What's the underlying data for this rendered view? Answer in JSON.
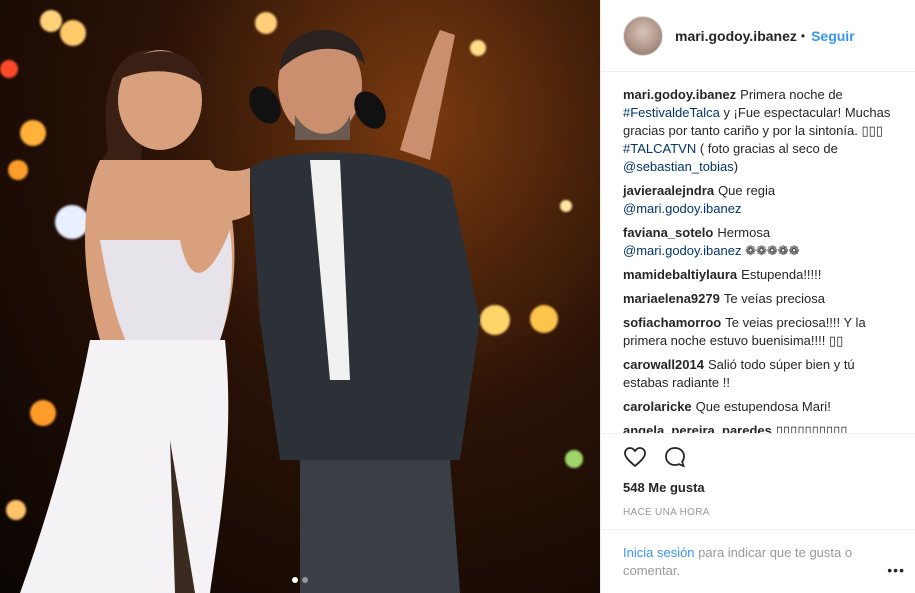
{
  "author": {
    "username": "mari.godoy.ibanez",
    "separator": "•",
    "follow_label": "Seguir"
  },
  "caption": {
    "username": "mari.godoy.ibanez",
    "text_1": "Primera noche de ",
    "hashtag_1": "#FestivaldeTalca",
    "text_2": " y ¡Fue espectacular! Muchas gracias por tanto cariño y por la sintonía. ▯▯▯ ",
    "hashtag_2": "#TALCATVN",
    "text_3": " ( foto gracias al seco de ",
    "mention": "@sebastian_tobias",
    "text_4": ")"
  },
  "comments": [
    {
      "user": "javieraalejndra",
      "text": "Que regia",
      "mention": "@mari.godoy.ibanez",
      "after": ""
    },
    {
      "user": "faviana_sotelo",
      "text": "Hermosa",
      "mention": "@mari.godoy.ibanez",
      "after": " ❁❁❁❁❁"
    },
    {
      "user": "mamidebaltiylaura",
      "text": "Estupenda!!!!!",
      "mention": "",
      "after": ""
    },
    {
      "user": "mariaelena9279",
      "text": "Te veías preciosa",
      "mention": "",
      "after": ""
    },
    {
      "user": "sofiachamorroo",
      "text": "Te veias preciosa!!!! Y la primera noche estuvo buenisima!!!! ▯▯",
      "mention": "",
      "after": ""
    },
    {
      "user": "carowall2014",
      "text": "Salió todo súper bien y tú estabas radiante !!",
      "mention": "",
      "after": ""
    },
    {
      "user": "carolaricke",
      "text": "Que estupendosa Mari!",
      "mention": "",
      "after": ""
    },
    {
      "user": "angela_pereira_paredes",
      "text": "▯▯▯▯▯▯▯▯▯▯",
      "mention": "",
      "after": ""
    }
  ],
  "actions": {
    "like_icon": "heart-icon",
    "comment_icon": "comment-bubble-icon"
  },
  "likes": "548 Me gusta",
  "timestamp": "HACE UNA HORA",
  "footer": {
    "login_link": "Inicia sesión",
    "prompt": " para indicar que te gusta o comentar.",
    "more_label": "•••"
  },
  "colors": {
    "link": "#3897f0",
    "tag": "#003569",
    "text": "#262626",
    "muted": "#999999"
  }
}
